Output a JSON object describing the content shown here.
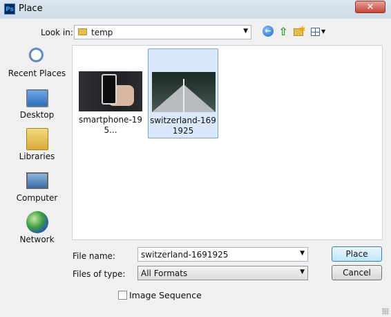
{
  "window": {
    "title": "Place",
    "app_icon": "Ps",
    "close_label": "✕"
  },
  "toolbar": {
    "look_in_label": "Look in:",
    "look_in_value": "temp",
    "icons": [
      "back-icon",
      "up-folder-icon",
      "new-folder-icon",
      "view-menu-icon"
    ]
  },
  "places": [
    {
      "label": "Recent Places",
      "icon": "recent-places-icon"
    },
    {
      "label": "Desktop",
      "icon": "desktop-icon"
    },
    {
      "label": "Libraries",
      "icon": "libraries-icon"
    },
    {
      "label": "Computer",
      "icon": "computer-icon"
    },
    {
      "label": "Network",
      "icon": "network-icon"
    }
  ],
  "files": [
    {
      "name": "smartphone-195...",
      "selected": false
    },
    {
      "name": "switzerland-1691925",
      "selected": true
    }
  ],
  "form": {
    "file_name_label": "File name:",
    "file_name_value": "switzerland-1691925",
    "files_of_type_label": "Files of type:",
    "files_of_type_value": "All Formats",
    "image_sequence_label": "Image Sequence",
    "image_sequence_checked": false
  },
  "buttons": {
    "place": "Place",
    "cancel": "Cancel"
  }
}
